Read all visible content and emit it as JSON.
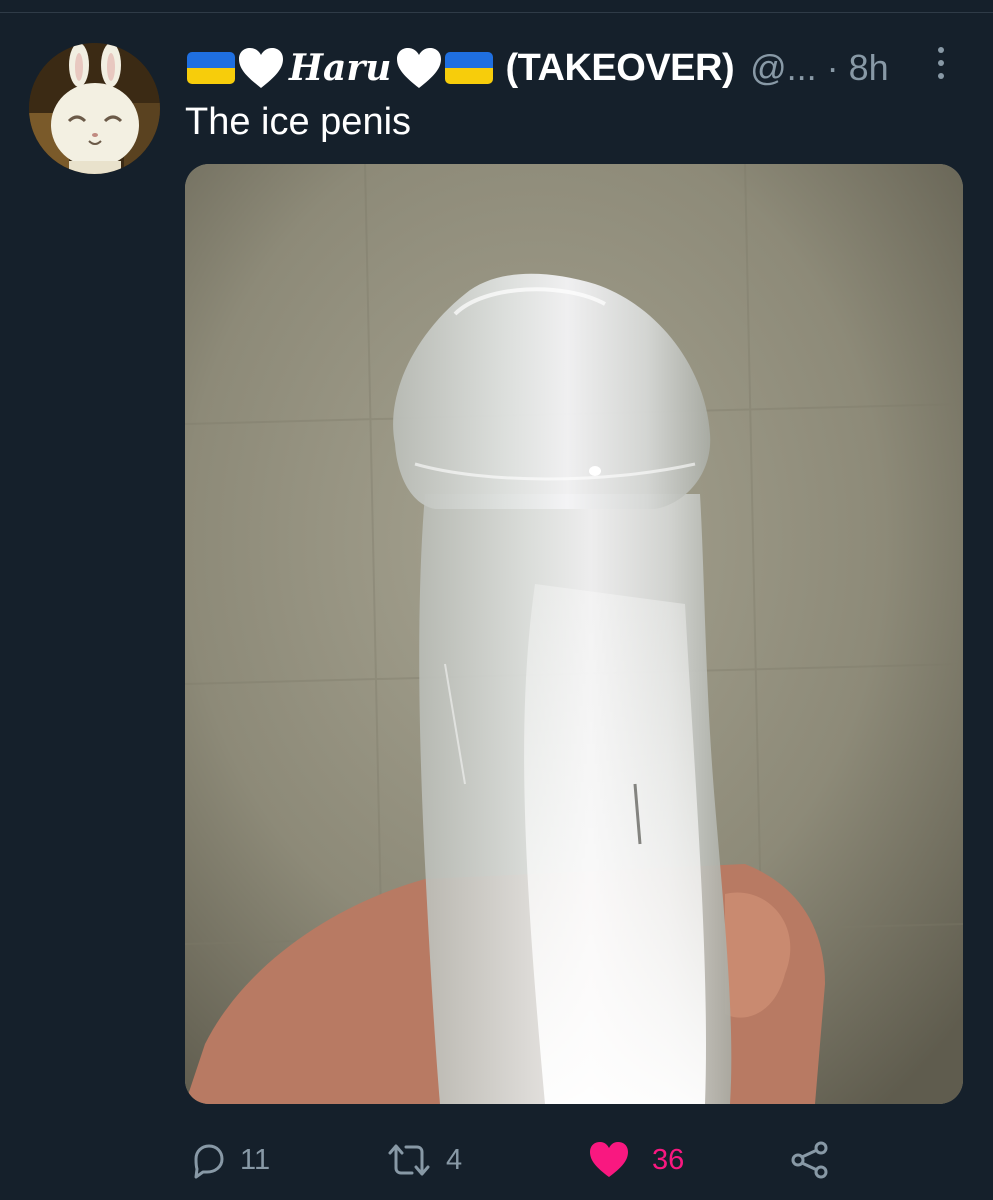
{
  "tweet": {
    "display_name_script": "Haru",
    "display_name_suffix": "(TAKEOVER)",
    "handle": "@...",
    "time": "· 8h",
    "text": "The ice penis"
  },
  "actions": {
    "reply_count": "11",
    "retweet_count": "4",
    "like_count": "36"
  },
  "icons": [
    "ukraine-flag",
    "white-heart",
    "more-vertical",
    "reply",
    "retweet",
    "heart-filled",
    "share"
  ],
  "colors": {
    "background": "#15202b",
    "secondary_text": "#8899a6",
    "like_pink": "#f91880",
    "flag_blue": "#1f6fe0",
    "flag_yellow": "#f7cd0b"
  }
}
